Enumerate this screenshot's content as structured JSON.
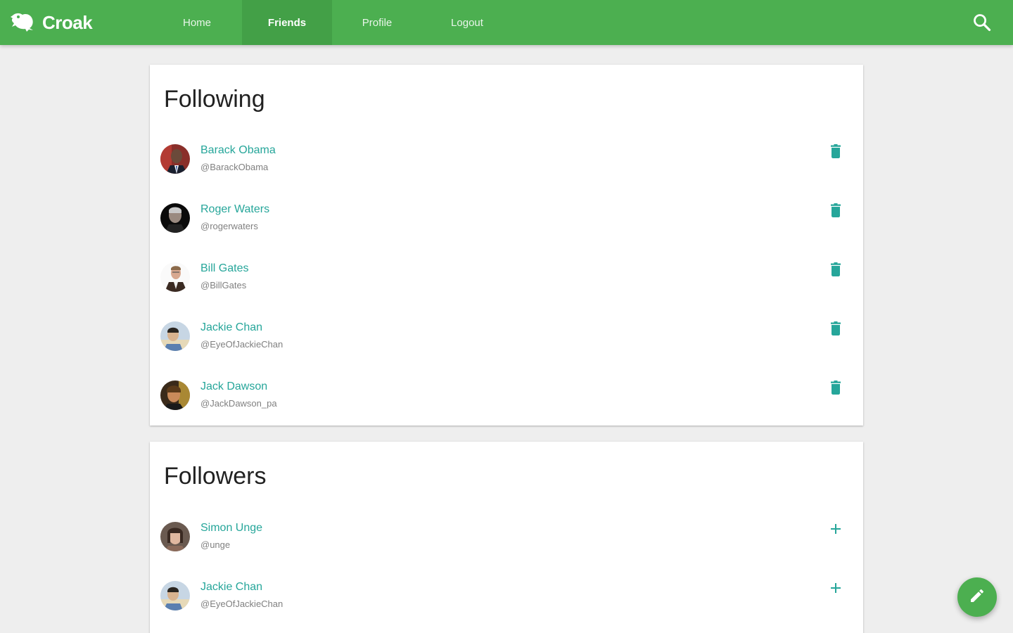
{
  "navbar": {
    "brand": "Croak",
    "brand_icon": "frog-logo-icon",
    "tabs": [
      {
        "label": "Home",
        "active": false
      },
      {
        "label": "Friends",
        "active": true
      },
      {
        "label": "Profile",
        "active": false
      },
      {
        "label": "Logout",
        "active": false
      }
    ],
    "search_icon": "search-icon"
  },
  "following": {
    "title": "Following",
    "action_icon": "trash-icon",
    "users": [
      {
        "name": "Barack Obama",
        "handle": "@BarackObama"
      },
      {
        "name": "Roger Waters",
        "handle": "@rogerwaters"
      },
      {
        "name": "Bill Gates",
        "handle": "@BillGates"
      },
      {
        "name": "Jackie Chan",
        "handle": "@EyeOfJackieChan"
      },
      {
        "name": "Jack Dawson",
        "handle": "@JackDawson_pa"
      }
    ]
  },
  "followers": {
    "title": "Followers",
    "action_icon": "plus-icon",
    "users": [
      {
        "name": "Simon Unge",
        "handle": "@unge"
      },
      {
        "name": "Jackie Chan",
        "handle": "@EyeOfJackieChan"
      }
    ]
  },
  "fab": {
    "icon": "pencil-icon"
  },
  "colors": {
    "primary": "#4caf50",
    "primary_dark": "#43a047",
    "accent": "#26a69a",
    "background": "#eeeeee"
  }
}
